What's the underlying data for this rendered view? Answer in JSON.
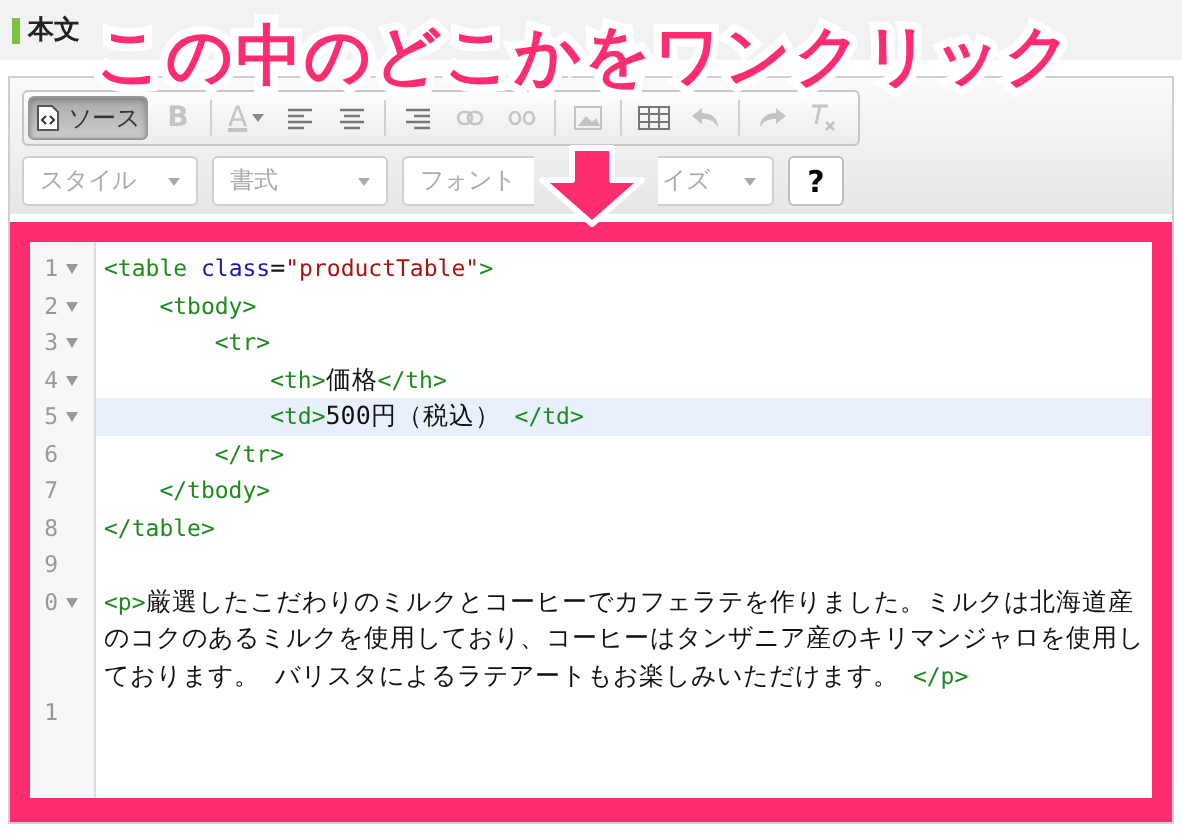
{
  "panel": {
    "title": "本文"
  },
  "annotation": {
    "text": "この中のどこかをワンクリック"
  },
  "toolbar": [
    {
      "kind": "source",
      "label": "ソース",
      "selected": true,
      "disabled": false
    },
    {
      "kind": "bold",
      "label": "B",
      "selected": false,
      "disabled": true
    },
    {
      "kind": "text-color",
      "label": "A",
      "selected": false,
      "disabled": true
    },
    {
      "kind": "align-left",
      "selected": false,
      "disabled": false
    },
    {
      "kind": "align-center",
      "selected": false,
      "disabled": false
    },
    {
      "kind": "align-right",
      "selected": false,
      "disabled": false
    },
    {
      "kind": "link",
      "selected": false,
      "disabled": true
    },
    {
      "kind": "unlink",
      "selected": false,
      "disabled": true
    },
    {
      "kind": "image",
      "selected": false,
      "disabled": true
    },
    {
      "kind": "table",
      "selected": false,
      "disabled": false
    },
    {
      "kind": "undo",
      "selected": false,
      "disabled": true
    },
    {
      "kind": "redo",
      "selected": false,
      "disabled": true
    },
    {
      "kind": "clear-format",
      "selected": false,
      "disabled": true
    }
  ],
  "dropdowns": [
    {
      "label": "スタイル"
    },
    {
      "label": "書式"
    },
    {
      "label": "フォント"
    },
    {
      "label": "イズ"
    }
  ],
  "help_button": {
    "label": "?"
  },
  "code_lines": [
    {
      "number": "1",
      "fold": true,
      "highlighted": false,
      "rows": [
        [
          {
            "kind": "tag",
            "text": "<table "
          },
          {
            "kind": "attr",
            "text": "class"
          },
          {
            "kind": "plain",
            "text": "="
          },
          {
            "kind": "string",
            "text": "\"productTable\""
          },
          {
            "kind": "tag",
            "text": ">"
          }
        ]
      ]
    },
    {
      "number": "2",
      "fold": true,
      "highlighted": false,
      "rows": [
        [
          {
            "kind": "tag",
            "text": "    <tbody>"
          }
        ]
      ]
    },
    {
      "number": "3",
      "fold": true,
      "highlighted": false,
      "rows": [
        [
          {
            "kind": "tag",
            "text": "        <tr>"
          }
        ]
      ]
    },
    {
      "number": "4",
      "fold": true,
      "highlighted": false,
      "rows": [
        [
          {
            "kind": "tag",
            "text": "            <th>"
          },
          {
            "kind": "plain",
            "text": "価格"
          },
          {
            "kind": "tag",
            "text": "</th>"
          }
        ]
      ]
    },
    {
      "number": "5",
      "fold": true,
      "highlighted": true,
      "rows": [
        [
          {
            "kind": "tag",
            "text": "            <td>"
          },
          {
            "kind": "plain",
            "text": "500円（税込）"
          },
          {
            "kind": "tag",
            "text": " </td>"
          }
        ]
      ]
    },
    {
      "number": "6",
      "fold": false,
      "highlighted": false,
      "rows": [
        [
          {
            "kind": "tag",
            "text": "        </tr>"
          }
        ]
      ]
    },
    {
      "number": "7",
      "fold": false,
      "highlighted": false,
      "rows": [
        [
          {
            "kind": "tag",
            "text": "    </tbody>"
          }
        ]
      ]
    },
    {
      "number": "8",
      "fold": false,
      "highlighted": false,
      "rows": [
        [
          {
            "kind": "tag",
            "text": "</table>"
          }
        ]
      ]
    },
    {
      "number": "9",
      "fold": false,
      "highlighted": false,
      "rows": [
        []
      ]
    },
    {
      "number": "0",
      "fold": true,
      "highlighted": false,
      "rows": [
        [
          {
            "kind": "tag",
            "text": "<p>"
          },
          {
            "kind": "plain",
            "text": "厳選したこだわりのミルクとコーヒーでカフェラテを作りました。ミルクは北海道産"
          }
        ],
        [
          {
            "kind": "plain",
            "text": "のコクのあるミルクを使用しており、コーヒーはタンザニア産のキリマンジャロを使用し"
          }
        ],
        [
          {
            "kind": "plain",
            "text": "ております。 バリスタによるラテアートもお楽しみいただけます。"
          },
          {
            "kind": "tag",
            "text": " </p>"
          }
        ]
      ]
    },
    {
      "number": "1",
      "fold": false,
      "highlighted": false,
      "rows": [
        []
      ]
    }
  ]
}
